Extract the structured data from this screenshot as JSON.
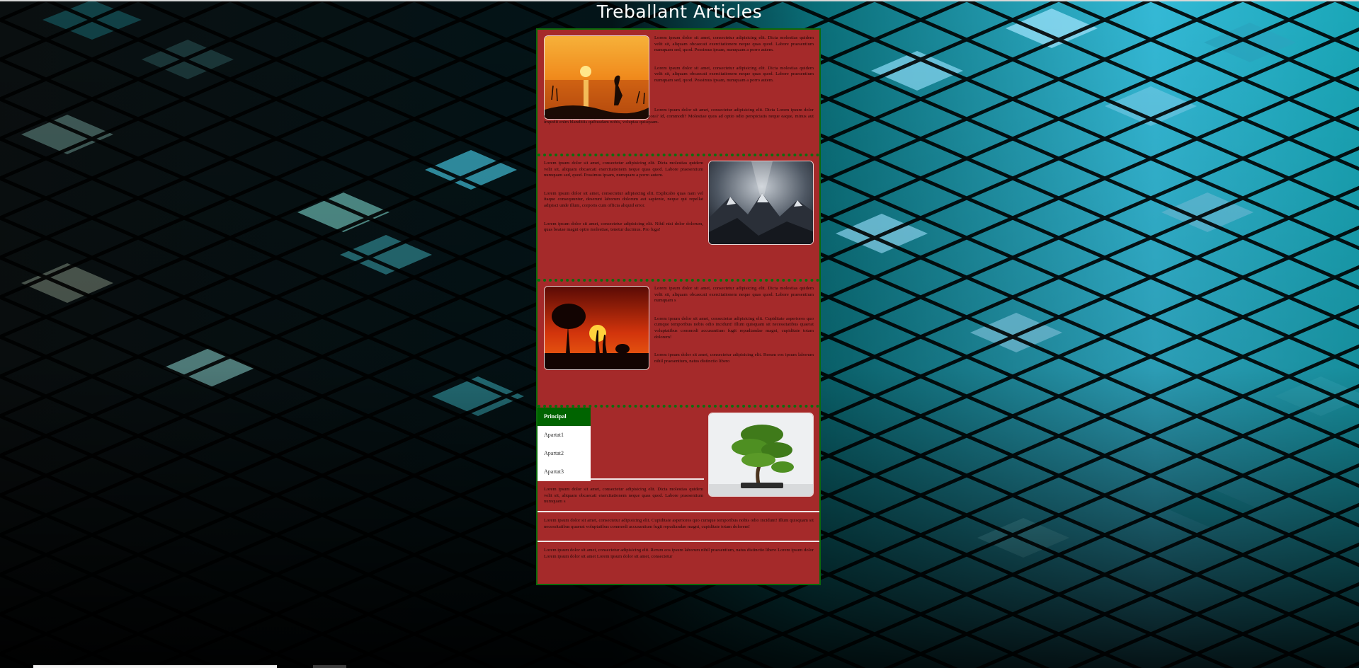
{
  "page": {
    "title": "Treballant Articles"
  },
  "articles": [
    {
      "paragraphs": [
        "Lorem ipsum dolor sit amet, consectetur adipisicing elit. Dicta molestias quidem velit sit, aliquam obcaecati exercitationem neque quas quod. Labore praesentium numquam sed, quod. Possimus ipsam, numquam a porro autem.",
        "Lorem ipsum dolor sit amet, consectetur adipisicing elit. Dicta molestias quidem velit sit, aliquam obcaecati exercitationem neque quas quod. Labore praesentium numquam sed, quod. Possimus ipsam, numquam a porro autem.",
        "Lorem ipsum dolor sit amet, consectetur adipisicing elit. Dicta Lorem ipsum dolor sit amet, consectetur adipisicing elit. Nulla eaque, tempora? Id, commodi? Molestiae quos ad optio odio perspiciatis neque eaque, minus aut impedit enim blanditiis quibusdam nobis, voluptas quisquam."
      ]
    },
    {
      "paragraphs": [
        "Lorem ipsum dolor sit amet, consectetur adipisicing elit. Dicta molestias quidem velit sit, aliquam obcaecati exercitationem neque quas quod. Labore praesentium numquam sed, quod. Possimus ipsam, numquam a porro autem.",
        "Lorem ipsum dolor sit amet, consectetur adipisicing elit. Explicabo quas nam vel itaque consequuntur, deserunt laborum dolorum aut sapiente, neque qui repellat adipisci unde illum, corporis cum officia aliquid error.",
        "Lorem ipsum dolor sit amet, consectetur adipisicing elit. Nihil nisi dolor dolorum, quas beatae magni optio molestiae, tenetur ducimus. Pro fuga!"
      ]
    },
    {
      "paragraphs": [
        "Lorem ipsum dolor sit amet, consectetur adipisicing elit. Dicta molestias quidem velit sit, aliquam obcaecati exercitationem neque quas quod. Labore praesentium numquam s",
        "Lorem ipsum dolor sit amet, consectetur adipisicing elit. Cupiditate asperiores quo cumque temporibus nobis odio incidunt! Illum quisquam sit necessitatibus quaerat voluptatibus commodi accusantium fugit repudiandae magni, cupiditate totam dolorem!",
        "Lorem ipsum dolor sit amet, consectetur adipisicing elit. Rerum eos ipsum laborum nihil praesentium, natus distinctio libero"
      ]
    },
    {
      "paragraphs": [
        "Lorem ipsum dolor sit amet, consectetur adipisicing elit. Dicta molestias quidem velit sit, aliquam obcaecati exercitationem neque quas quod. Labore praesentium numquam s",
        "Lorem ipsum dolor sit amet, consectetur adipisicing elit. Cupiditate asperiores quo cumque temporibus nobis odio incidunt! Illum quisquam sit necessitatibus quaerat voluptatibus commodi accusantium fugit repudiandae magni, cupiditate totam dolorem!",
        "Lorem ipsum dolor sit amet, consectetur adipisicing elit. Rerum eos ipsum laborum nihil praesentium, natus distinctio libero Lorem ipsum dolor Lorem ipsum dolor sit amet Lorem ipsum dolor sit amet, consectetur"
      ]
    }
  ],
  "menu": {
    "items": [
      "Principal",
      "Apartat1",
      "Apartat2",
      "Apartat3"
    ]
  },
  "colors": {
    "panel": "#a52a2a",
    "panel_border": "#0b6a0b",
    "menu_active": "#006400",
    "title_text": "#ffffff"
  },
  "icons": {
    "article1_image": "heron-sunset-image",
    "article2_image": "mountain-storm-image",
    "article3_image": "savanna-sunset-image",
    "article4_image": "bonsai-tree-image"
  }
}
